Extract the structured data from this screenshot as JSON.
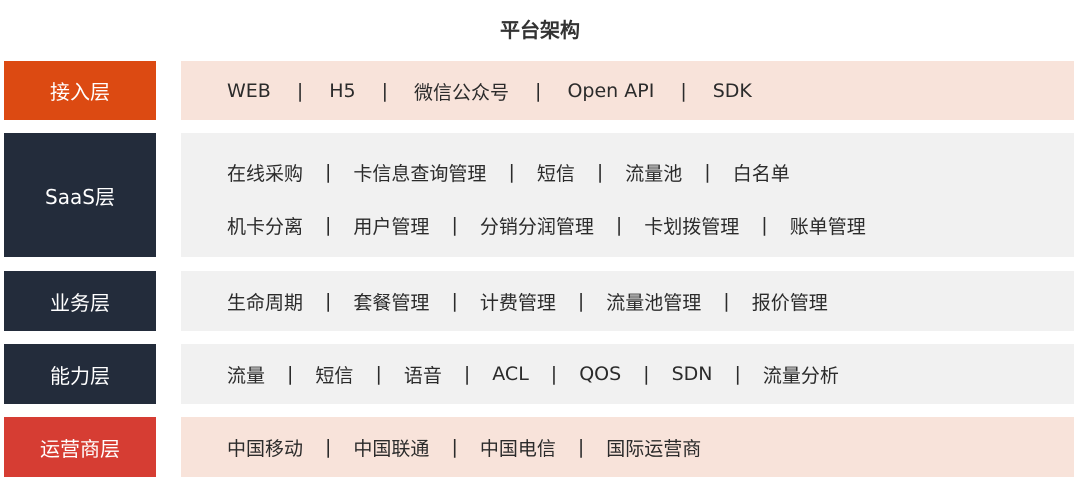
{
  "title": "平台架构",
  "separator": "|",
  "colors": {
    "orange": "#dc4a12",
    "navy": "#232c3b",
    "red": "#d63d33",
    "peach": "#f8e3da",
    "gray": "#f1f1f1"
  },
  "layers": [
    {
      "label": "接入层",
      "rows": [
        [
          "WEB",
          "H5",
          "微信公众号",
          "Open API",
          "SDK"
        ]
      ]
    },
    {
      "label": "SaaS层",
      "rows": [
        [
          "在线采购",
          "卡信息查询管理",
          "短信",
          "流量池",
          "白名单"
        ],
        [
          "机卡分离",
          "用户管理",
          "分销分润管理",
          "卡划拨管理",
          "账单管理"
        ]
      ]
    },
    {
      "label": "业务层",
      "rows": [
        [
          "生命周期",
          "套餐管理",
          "计费管理",
          "流量池管理",
          "报价管理"
        ]
      ]
    },
    {
      "label": "能力层",
      "rows": [
        [
          "流量",
          "短信",
          "语音",
          "ACL",
          "QOS",
          "SDN",
          "流量分析"
        ]
      ]
    },
    {
      "label": "运营商层",
      "rows": [
        [
          "中国移动",
          "中国联通",
          "中国电信",
          "国际运营商"
        ]
      ]
    }
  ]
}
